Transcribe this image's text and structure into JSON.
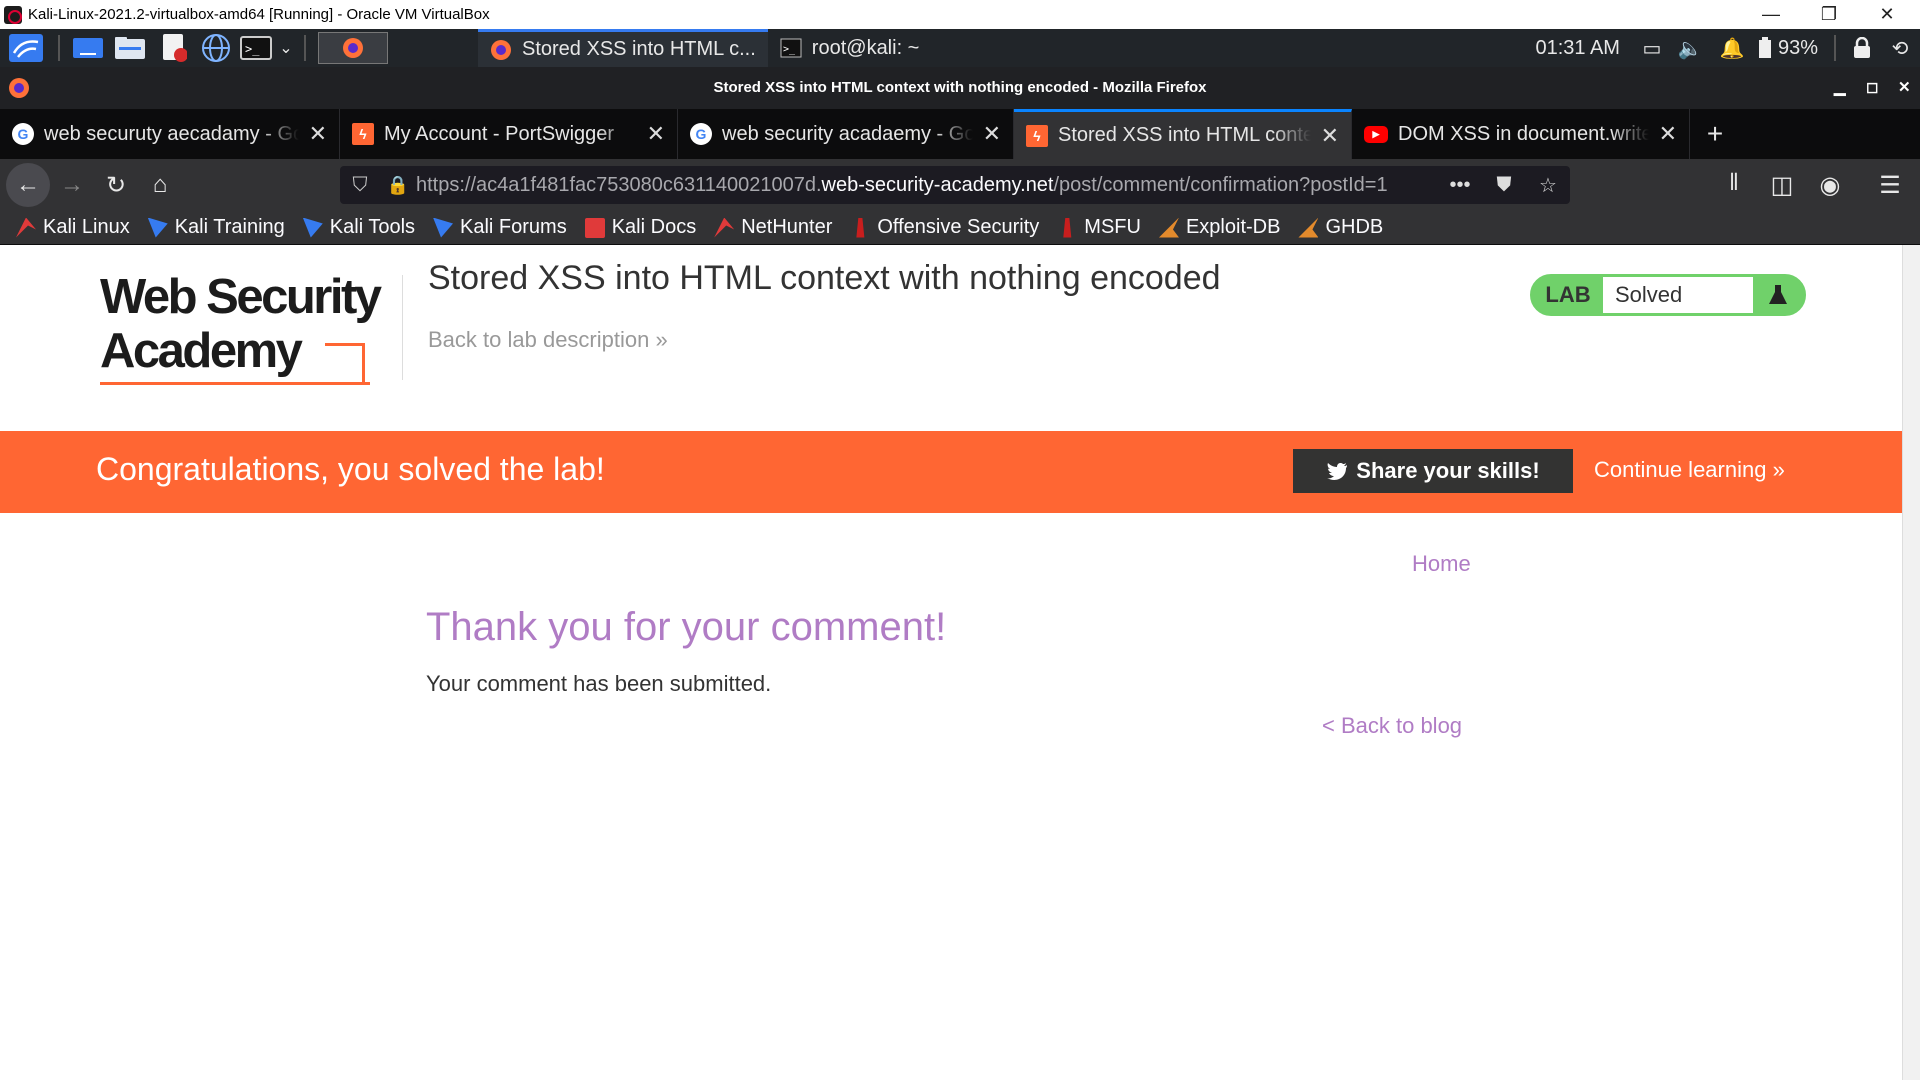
{
  "vbox": {
    "title": "Kali-Linux-2021.2-virtualbox-amd64 [Running] - Oracle VM VirtualBox",
    "minimize": "—",
    "restore": "❐",
    "close": "✕"
  },
  "panel": {
    "task_firefox": "Stored XSS into HTML c...",
    "task_terminal": "root@kali: ~",
    "clock": "01:31 AM",
    "battery": "93%"
  },
  "firefox": {
    "window_title": "Stored XSS into HTML context with nothing encoded - Mozilla Firefox",
    "tabs": [
      {
        "label": "web securuty aecadamy - Google Search",
        "icon": "google-icon"
      },
      {
        "label": "My Account - PortSwigger",
        "icon": "portswigger-icon"
      },
      {
        "label": "web security acadaemy - Google Search",
        "icon": "google-icon"
      },
      {
        "label": "Stored XSS into HTML context with nothing encoded",
        "icon": "portswigger-icon"
      },
      {
        "label": "DOM XSS in document.write sink",
        "icon": "youtube-icon"
      }
    ],
    "new_tab": "+",
    "url_prefix": "https://ac4a1f481fac753080c631140021007d.",
    "url_domain": "web-security-academy.net",
    "url_path": "/post/comment/confirmation?postId=1",
    "url_more": "•••",
    "bookmarks": [
      {
        "label": "Kali Linux",
        "color": "#e03a3a"
      },
      {
        "label": "Kali Training",
        "color": "#367bf0"
      },
      {
        "label": "Kali Tools",
        "color": "#367bf0"
      },
      {
        "label": "Kali Forums",
        "color": "#367bf0"
      },
      {
        "label": "Kali Docs",
        "color": "#e03a3a"
      },
      {
        "label": "NetHunter",
        "color": "#e03a3a"
      },
      {
        "label": "Offensive Security",
        "color": "#c81e1e"
      },
      {
        "label": "MSFU",
        "color": "#c81e1e"
      },
      {
        "label": "Exploit-DB",
        "color": "#e38a2c"
      },
      {
        "label": "GHDB",
        "color": "#e38a2c"
      }
    ]
  },
  "page": {
    "logo_line1": "Web Security",
    "logo_line2": "Academy",
    "lab_title": "Stored XSS into HTML context with nothing encoded",
    "back_to_description": "Back to lab description »",
    "lab_label": "LAB",
    "lab_status": "Solved",
    "congrats": "Congratulations, you solved the lab!",
    "share": "Share your skills!",
    "continue": "Continue learning »",
    "home": "Home",
    "thanks": "Thank you for your comment!",
    "submitted": "Your comment has been submitted.",
    "back_to_blog": "< Back to blog",
    "accent": "#ff6633",
    "link_color": "#b07cc5",
    "solved_color": "#70d16a"
  }
}
